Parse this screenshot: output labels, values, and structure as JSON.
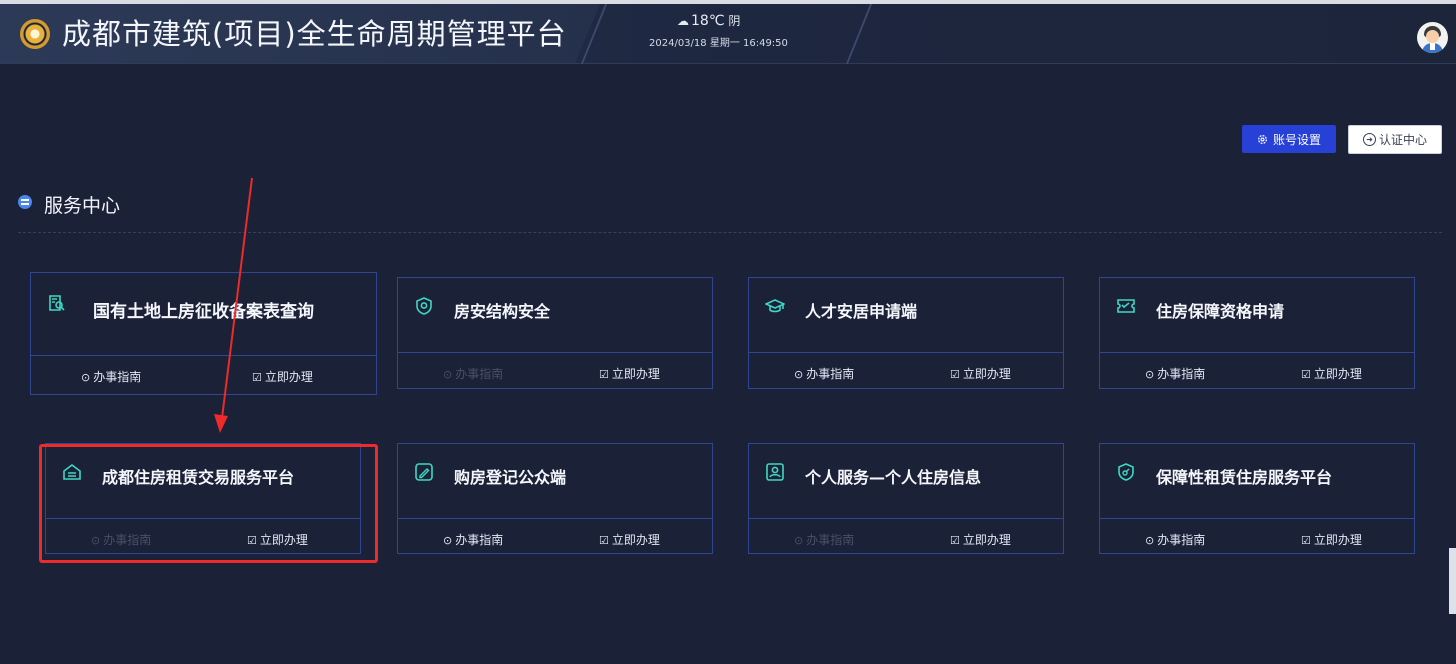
{
  "header": {
    "app_title": "成都市建筑(项目)全生命周期管理平台",
    "weather_icon": "cloud-icon",
    "temperature": "18℃",
    "condition": "阴",
    "datetime": "2024/03/18 星期一 16:49:50"
  },
  "actions": {
    "account_settings": "账号设置",
    "cert_center": "认证中心"
  },
  "section": {
    "title": "服务中心"
  },
  "cards": [
    {
      "title": "国有土地上房征收备案表查询",
      "guide": "办事指南",
      "handle": "立即办理",
      "icon": "document-search-icon"
    },
    {
      "title": "房安结构安全",
      "guide": "办事指南",
      "handle": "立即办理",
      "icon": "shield-icon"
    },
    {
      "title": "人才安居申请端",
      "guide": "办事指南",
      "handle": "立即办理",
      "icon": "graduation-cap-icon"
    },
    {
      "title": "住房保障资格申请",
      "guide": "办事指南",
      "handle": "立即办理",
      "icon": "ticket-icon"
    },
    {
      "title": "成都住房租赁交易服务平台",
      "guide": "办事指南",
      "handle": "立即办理",
      "icon": "home-icon"
    },
    {
      "title": "购房登记公众端",
      "guide": "办事指南",
      "handle": "立即办理",
      "icon": "edit-icon"
    },
    {
      "title": "个人服务—个人住房信息",
      "guide": "办事指南",
      "handle": "立即办理",
      "icon": "id-card-icon"
    },
    {
      "title": "保障性租赁住房服务平台",
      "guide": "办事指南",
      "handle": "立即办理",
      "icon": "shield-key-icon"
    }
  ],
  "colors": {
    "background": "#1b2137",
    "card_border": "#2f4792",
    "primary_button": "#2740d6",
    "highlight_red": "#ee2a2a"
  }
}
